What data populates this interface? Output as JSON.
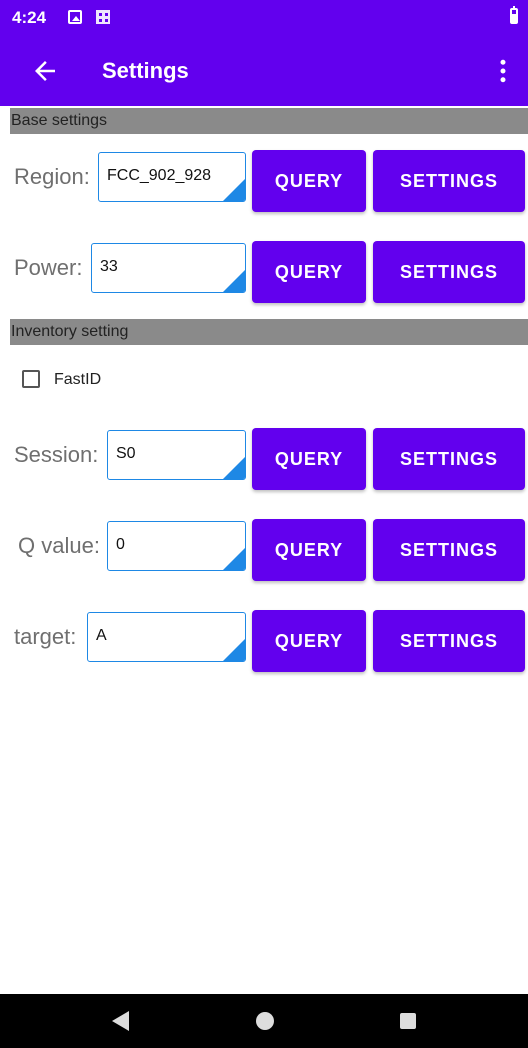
{
  "status_bar": {
    "time": "4:24",
    "icons": [
      "image-icon",
      "qr-code-icon",
      "battery-icon"
    ]
  },
  "app_bar": {
    "title": "Settings",
    "back_icon": "arrow-left-icon",
    "menu_icon": "more-vertical-icon"
  },
  "sections": {
    "base": "Base settings",
    "inventory": "Inventory setting"
  },
  "rows": {
    "region": {
      "label": "Region:",
      "value": "FCC_902_928",
      "query": "QUERY",
      "settings": "SETTINGS"
    },
    "power": {
      "label": "Power:",
      "value": "33",
      "query": "QUERY",
      "settings": "SETTINGS"
    },
    "session": {
      "label": "Session:",
      "value": "S0",
      "query": "QUERY",
      "settings": "SETTINGS"
    },
    "qvalue": {
      "label": "Q value:",
      "value": "0",
      "query": "QUERY",
      "settings": "SETTINGS"
    },
    "target": {
      "label": "target:",
      "value": "A",
      "query": "QUERY",
      "settings": "SETTINGS"
    }
  },
  "fastid": {
    "label": "FastID",
    "checked": false
  },
  "colors": {
    "primary": "#6200ee",
    "section_header": "#8a8a8a",
    "spinner_accent": "#1e88e5"
  },
  "nav_bar": [
    "back-icon",
    "home-icon",
    "recents-icon"
  ]
}
